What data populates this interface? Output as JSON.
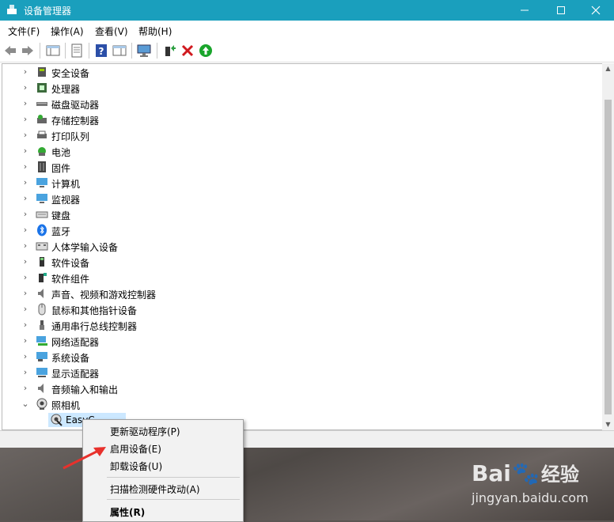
{
  "window": {
    "title": "设备管理器"
  },
  "menu": [
    "文件(F)",
    "操作(A)",
    "查看(V)",
    "帮助(H)"
  ],
  "tree": {
    "items": [
      {
        "label": "安全设备",
        "icon": "security-device-icon"
      },
      {
        "label": "处理器",
        "icon": "processor-icon"
      },
      {
        "label": "磁盘驱动器",
        "icon": "disk-drive-icon"
      },
      {
        "label": "存储控制器",
        "icon": "storage-controller-icon"
      },
      {
        "label": "打印队列",
        "icon": "printer-icon"
      },
      {
        "label": "电池",
        "icon": "battery-icon"
      },
      {
        "label": "固件",
        "icon": "firmware-icon"
      },
      {
        "label": "计算机",
        "icon": "computer-icon"
      },
      {
        "label": "监视器",
        "icon": "monitor-icon"
      },
      {
        "label": "键盘",
        "icon": "keyboard-icon"
      },
      {
        "label": "蓝牙",
        "icon": "bluetooth-icon"
      },
      {
        "label": "人体学输入设备",
        "icon": "hid-icon"
      },
      {
        "label": "软件设备",
        "icon": "software-device-icon"
      },
      {
        "label": "软件组件",
        "icon": "software-component-icon"
      },
      {
        "label": "声音、视频和游戏控制器",
        "icon": "speaker-icon"
      },
      {
        "label": "鼠标和其他指针设备",
        "icon": "mouse-icon"
      },
      {
        "label": "通用串行总线控制器",
        "icon": "usb-icon"
      },
      {
        "label": "网络适配器",
        "icon": "network-adapter-icon"
      },
      {
        "label": "系统设备",
        "icon": "system-device-icon"
      },
      {
        "label": "显示适配器",
        "icon": "display-adapter-icon"
      },
      {
        "label": "音频输入和输出",
        "icon": "audio-io-icon"
      },
      {
        "label": "照相机",
        "icon": "camera-icon"
      }
    ],
    "child": {
      "label": "EasyC",
      "icon": "webcam-disabled-icon"
    }
  },
  "context_menu": {
    "items": [
      "更新驱动程序(P)",
      "启用设备(E)",
      "卸载设备(U)",
      "扫描检测硬件改动(A)",
      "属性(R)"
    ]
  },
  "watermark": {
    "brand": "Bai",
    "brand_suffix": "经验",
    "url": "jingyan.baidu.com"
  },
  "colors": {
    "titlebar": "#1a9fbd",
    "selection": "#cce8ff",
    "arrow": "#e8312c"
  }
}
